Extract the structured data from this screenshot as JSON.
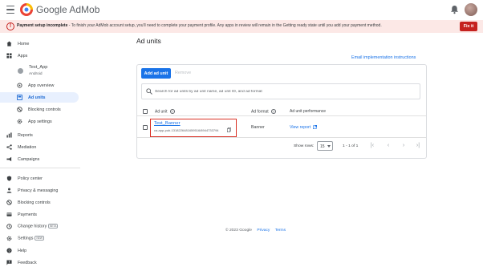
{
  "app": {
    "brand": "Google AdMob"
  },
  "banner": {
    "title": "Payment setup incomplete",
    "message": " - To finish your AdMob account setup, you'll need to complete your payment profile. Any apps in review will remain in the Getting ready state until you add your payment method.",
    "fix_label": "Fix it"
  },
  "sidebar": {
    "home": "Home",
    "apps": "Apps",
    "app_name": "Test_App",
    "app_os": "Android",
    "app_overview": "App overview",
    "ad_units": "Ad units",
    "blocking_controls": "Blocking controls",
    "app_settings": "App settings",
    "reports": "Reports",
    "mediation": "Mediation",
    "campaigns": "Campaigns",
    "policy_center": "Policy center",
    "privacy_messaging": "Privacy & messaging",
    "blocking_controls_2": "Blocking controls",
    "payments": "Payments",
    "change_history": "Change history",
    "change_history_badge": "BETA",
    "settings": "Settings",
    "settings_badge": "NEW",
    "help": "Help",
    "feedback": "Feedback"
  },
  "main": {
    "title": "Ad units",
    "email_link": "Email implementation instructions",
    "add_button": "Add ad unit",
    "remove_button": "Remove",
    "search_placeholder": "Search for ad units by ad unit name, ad unit ID, and ad format",
    "columns": {
      "ad_unit": "Ad unit",
      "ad_format": "Ad format",
      "performance": "Ad unit performance"
    },
    "row": {
      "name": "Test_Banner",
      "id": "ca-app-pub-1318226481659516/8944733794",
      "format": "Banner",
      "view_report": "View report"
    },
    "pager": {
      "rows_label": "Show rows:",
      "rows_value": "15",
      "range": "1 - 1 of 1"
    }
  },
  "footer": {
    "copyright": "© 2023 Google",
    "privacy": "Privacy",
    "terms": "Terms"
  },
  "colors": {
    "accent": "#1a73e8",
    "error": "#c5221f",
    "highlight": "#d93025"
  }
}
